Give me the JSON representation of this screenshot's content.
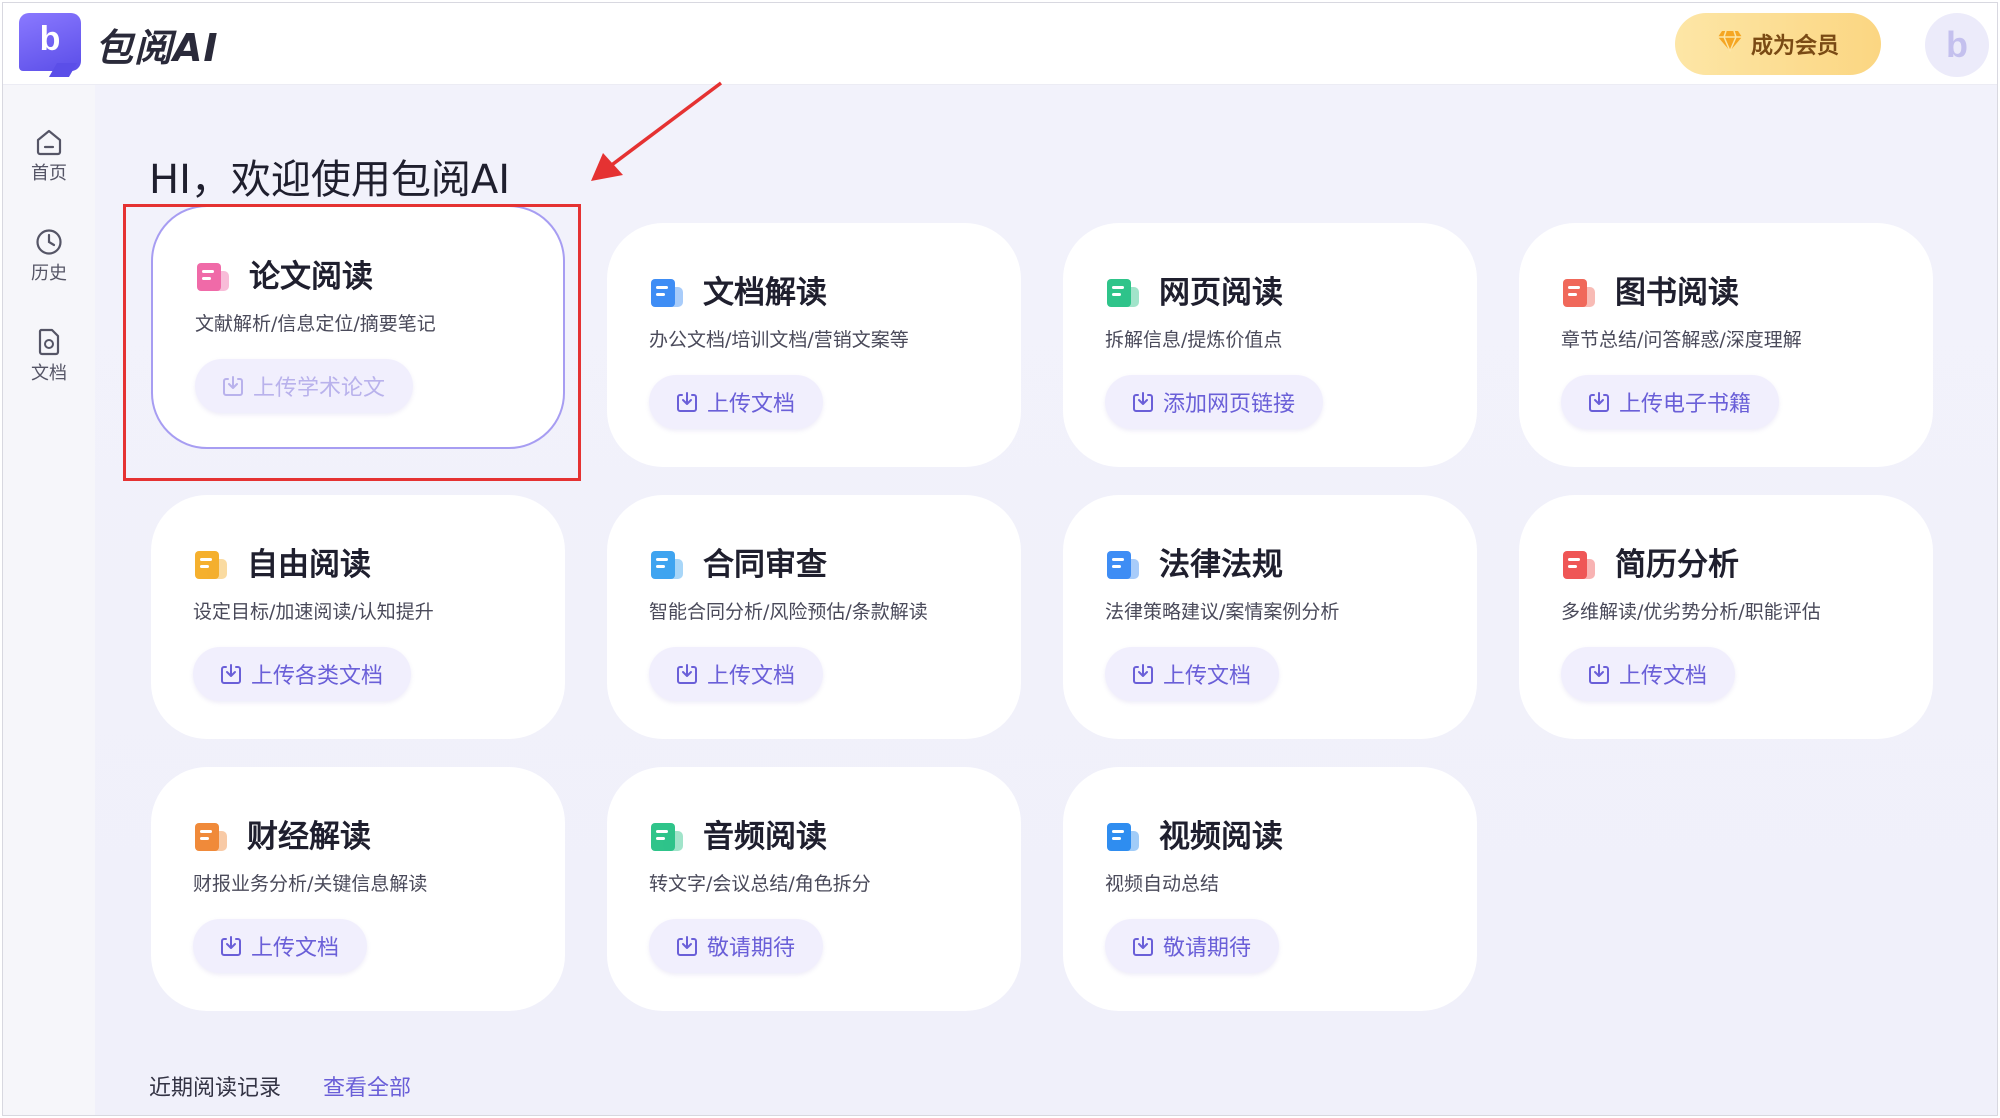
{
  "header": {
    "logo_letter": "b",
    "brand": "包阅AI",
    "vip_label": "成为会员",
    "avatar_letter": "b"
  },
  "sidebar": {
    "items": [
      {
        "label": "首页",
        "icon": "home-icon"
      },
      {
        "label": "历史",
        "icon": "clock-icon"
      },
      {
        "label": "文档",
        "icon": "document-icon"
      }
    ]
  },
  "main": {
    "greeting": "HI，欢迎使用包阅AI",
    "cards": [
      {
        "title": "论文阅读",
        "desc": "文献解析/信息定位/摘要笔记",
        "action": "上传学术论文",
        "icon_color": "#f06aa8",
        "selected": true
      },
      {
        "title": "文档解读",
        "desc": "办公文档/培训文档/营销文案等",
        "action": "上传文档",
        "icon_color": "#3e8df5"
      },
      {
        "title": "网页阅读",
        "desc": "拆解信息/提炼价值点",
        "action": "添加网页链接",
        "icon_color": "#2fc48a"
      },
      {
        "title": "图书阅读",
        "desc": "章节总结/问答解惑/深度理解",
        "action": "上传电子书籍",
        "icon_color": "#f0685a"
      },
      {
        "title": "自由阅读",
        "desc": "设定目标/加速阅读/认知提升",
        "action": "上传各类文档",
        "icon_color": "#f5b02e"
      },
      {
        "title": "合同审查",
        "desc": "智能合同分析/风险预估/条款解读",
        "action": "上传文档",
        "icon_color": "#3fa4f0"
      },
      {
        "title": "法律法规",
        "desc": "法律策略建议/案情案例分析",
        "action": "上传文档",
        "icon_color": "#3e8df5"
      },
      {
        "title": "简历分析",
        "desc": "多维解读/优劣势分析/职能评估",
        "action": "上传文档",
        "icon_color": "#ef5656"
      },
      {
        "title": "财经解读",
        "desc": "财报业务分析/关键信息解读",
        "action": "上传文档",
        "icon_color": "#f08a3a"
      },
      {
        "title": "音频阅读",
        "desc": "转文字/会议总结/角色拆分",
        "action": "敬请期待",
        "icon_color": "#2fc48a"
      },
      {
        "title": "视频阅读",
        "desc": "视频自动总结",
        "action": "敬请期待",
        "icon_color": "#2f8df0"
      }
    ],
    "recent_label": "近期阅读记录",
    "recent_link": "查看全部"
  },
  "colors": {
    "accent": "#6a5fd8",
    "highlight_red": "#e53232",
    "vip_gold": "#fbd682"
  }
}
